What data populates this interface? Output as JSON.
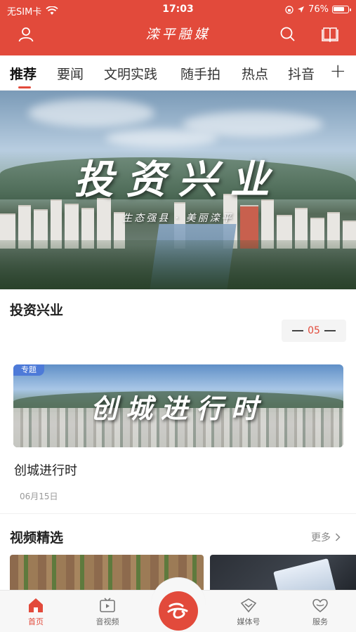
{
  "status_bar": {
    "carrier": "无SIM卡",
    "time": "17:03",
    "battery": "76%"
  },
  "header": {
    "title": "滦平融媒",
    "icons": [
      "user-icon",
      "search-icon",
      "book-icon"
    ]
  },
  "tabs": [
    {
      "label": "推荐",
      "active": true
    },
    {
      "label": "要闻"
    },
    {
      "label": "文明实践"
    },
    {
      "label": "随手拍"
    },
    {
      "label": "热点"
    },
    {
      "label": "抖音"
    }
  ],
  "hero": {
    "title": "投资兴业",
    "subtitle": "生态强县 · 美丽滦平"
  },
  "section1": {
    "title": "投资兴业",
    "page_number": "05"
  },
  "card": {
    "badge": "专题",
    "image_title": "创城进行时",
    "title": "创城进行时",
    "date": "06月15日"
  },
  "video_section": {
    "title": "视频精选",
    "more": "更多"
  },
  "bottom_nav": [
    {
      "label": "首页",
      "icon": "home-icon",
      "active": true
    },
    {
      "label": "音视频",
      "icon": "video-icon"
    },
    {
      "label": "媒体号",
      "icon": "media-icon"
    },
    {
      "label": "服务",
      "icon": "heart-icon"
    }
  ],
  "colors": {
    "brand": "#e24a3b",
    "badge": "#4d7ad8"
  }
}
